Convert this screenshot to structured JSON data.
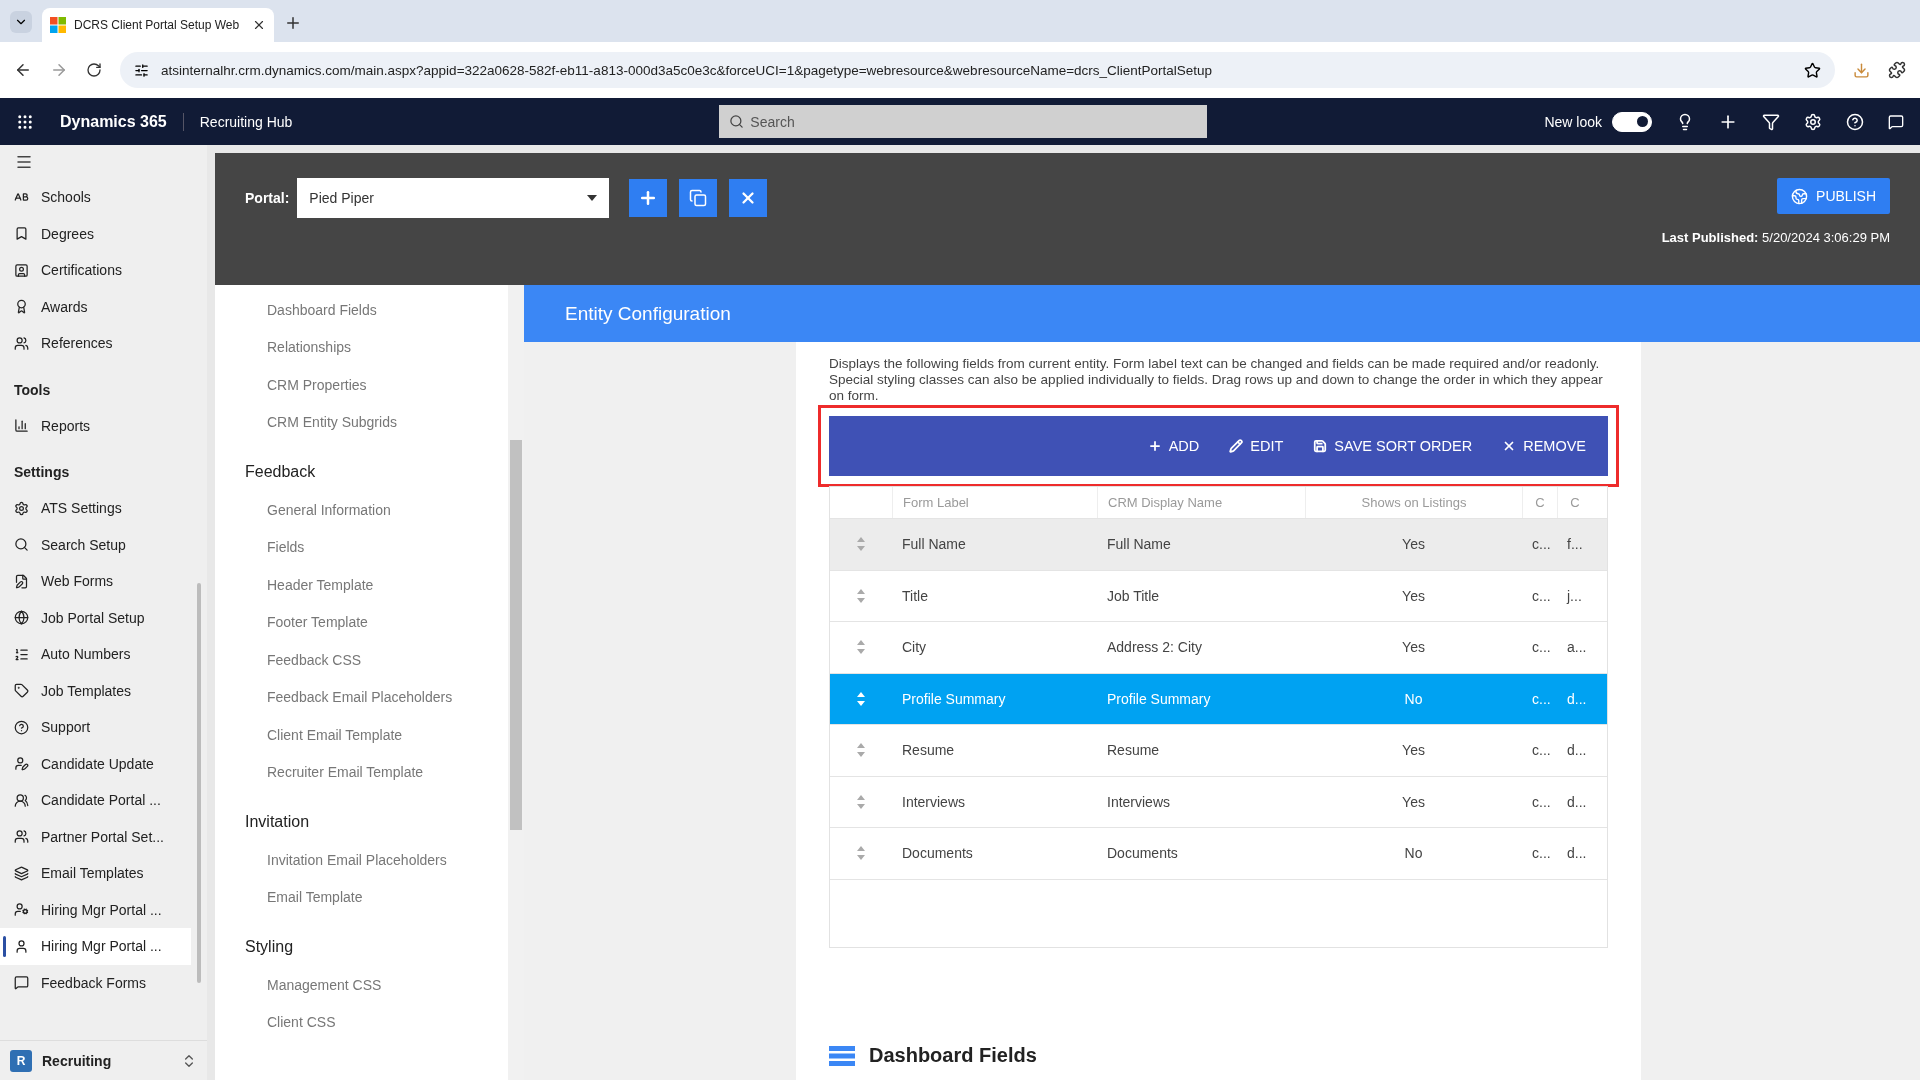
{
  "browser": {
    "tab_title": "DCRS Client Portal Setup Web",
    "url": "atsinternalhr.crm.dynamics.com/main.aspx?appid=322a0628-582f-eb11-a813-000d3a5c0e3c&forceUCI=1&pagetype=webresource&webresourceName=dcrs_ClientPortalSetup"
  },
  "app_bar": {
    "app_name": "Dynamics 365",
    "area_name": "Recruiting Hub",
    "search_placeholder": "Search",
    "new_look_label": "New look",
    "new_look_on": true
  },
  "sidebar": {
    "groups": [
      {
        "items": [
          {
            "label": "Schools",
            "selected": false
          },
          {
            "label": "Degrees",
            "selected": false
          },
          {
            "label": "Certifications",
            "selected": false
          },
          {
            "label": "Awards",
            "selected": false
          },
          {
            "label": "References",
            "selected": false
          }
        ]
      },
      {
        "title": "Tools",
        "items": [
          {
            "label": "Reports",
            "selected": false
          }
        ]
      },
      {
        "title": "Settings",
        "items": [
          {
            "label": "ATS Settings",
            "selected": false
          },
          {
            "label": "Search Setup",
            "selected": false
          },
          {
            "label": "Web Forms",
            "selected": false
          },
          {
            "label": "Job Portal Setup",
            "selected": false
          },
          {
            "label": "Auto Numbers",
            "selected": false
          },
          {
            "label": "Job Templates",
            "selected": false
          },
          {
            "label": "Support",
            "selected": false
          },
          {
            "label": "Candidate Update",
            "selected": false
          },
          {
            "label": "Candidate Portal ...",
            "selected": false
          },
          {
            "label": "Partner Portal Set...",
            "selected": false
          },
          {
            "label": "Email Templates",
            "selected": false
          },
          {
            "label": "Hiring Mgr Portal ...",
            "selected": false
          },
          {
            "label": "Hiring Mgr Portal ...",
            "selected": true
          },
          {
            "label": "Feedback Forms",
            "selected": false
          }
        ]
      }
    ],
    "area": {
      "badge": "R",
      "label": "Recruiting"
    }
  },
  "portal": {
    "label": "Portal:",
    "value": "Pied Piper",
    "publish": "PUBLISH",
    "last_published_label": "Last Published:",
    "last_published_value": "5/20/2024 3:06:29 PM"
  },
  "section_nav": {
    "groups": [
      {
        "items": [
          "Dashboard Fields",
          "Relationships",
          "CRM Properties",
          "CRM Entity Subgrids"
        ]
      },
      {
        "title": "Feedback",
        "items": [
          "General Information",
          "Fields",
          "Header Template",
          "Footer Template",
          "Feedback CSS",
          "Feedback Email Placeholders",
          "Client Email Template",
          "Recruiter Email Template"
        ]
      },
      {
        "title": "Invitation",
        "items": [
          "Invitation Email Placeholders",
          "Email Template"
        ]
      },
      {
        "title": "Styling",
        "items": [
          "Management CSS",
          "Client CSS"
        ]
      }
    ]
  },
  "entity_config": {
    "title": "Entity Configuration",
    "fields": {
      "description": "Displays the following fields from current entity. Form label text can be changed and fields can be made required and/or readonly. Special styling classes can also be applied individually to fields. Drag rows up and down to change the order in which they appear on form.",
      "toolbar": [
        {
          "kind": "add",
          "label": "ADD"
        },
        {
          "kind": "edit",
          "label": "EDIT"
        },
        {
          "kind": "save",
          "label": "SAVE SORT ORDER"
        },
        {
          "kind": "remove",
          "label": "REMOVE"
        }
      ],
      "columns": [
        "Form Label",
        "CRM Display Name",
        "Shows on Listings",
        "C",
        "C"
      ],
      "rows": [
        {
          "cells": [
            "Full Name",
            "Full Name",
            "Yes",
            "c...",
            "f..."
          ],
          "selected": false,
          "hovered": true
        },
        {
          "cells": [
            "Title",
            "Job Title",
            "Yes",
            "c...",
            "j..."
          ],
          "selected": false,
          "hovered": false
        },
        {
          "cells": [
            "City",
            "Address 2: City",
            "Yes",
            "c...",
            "a..."
          ],
          "selected": false,
          "hovered": false
        },
        {
          "cells": [
            "Profile Summary",
            "Profile Summary",
            "No",
            "c...",
            "d..."
          ],
          "selected": true,
          "hovered": false
        },
        {
          "cells": [
            "Resume",
            "Resume",
            "Yes",
            "c...",
            "d..."
          ],
          "selected": false,
          "hovered": false
        },
        {
          "cells": [
            "Interviews",
            "Interviews",
            "Yes",
            "c...",
            "d..."
          ],
          "selected": false,
          "hovered": false
        },
        {
          "cells": [
            "Documents",
            "Documents",
            "No",
            "c...",
            "d..."
          ],
          "selected": false,
          "hovered": false
        }
      ]
    },
    "next_section": "Dashboard Fields"
  }
}
